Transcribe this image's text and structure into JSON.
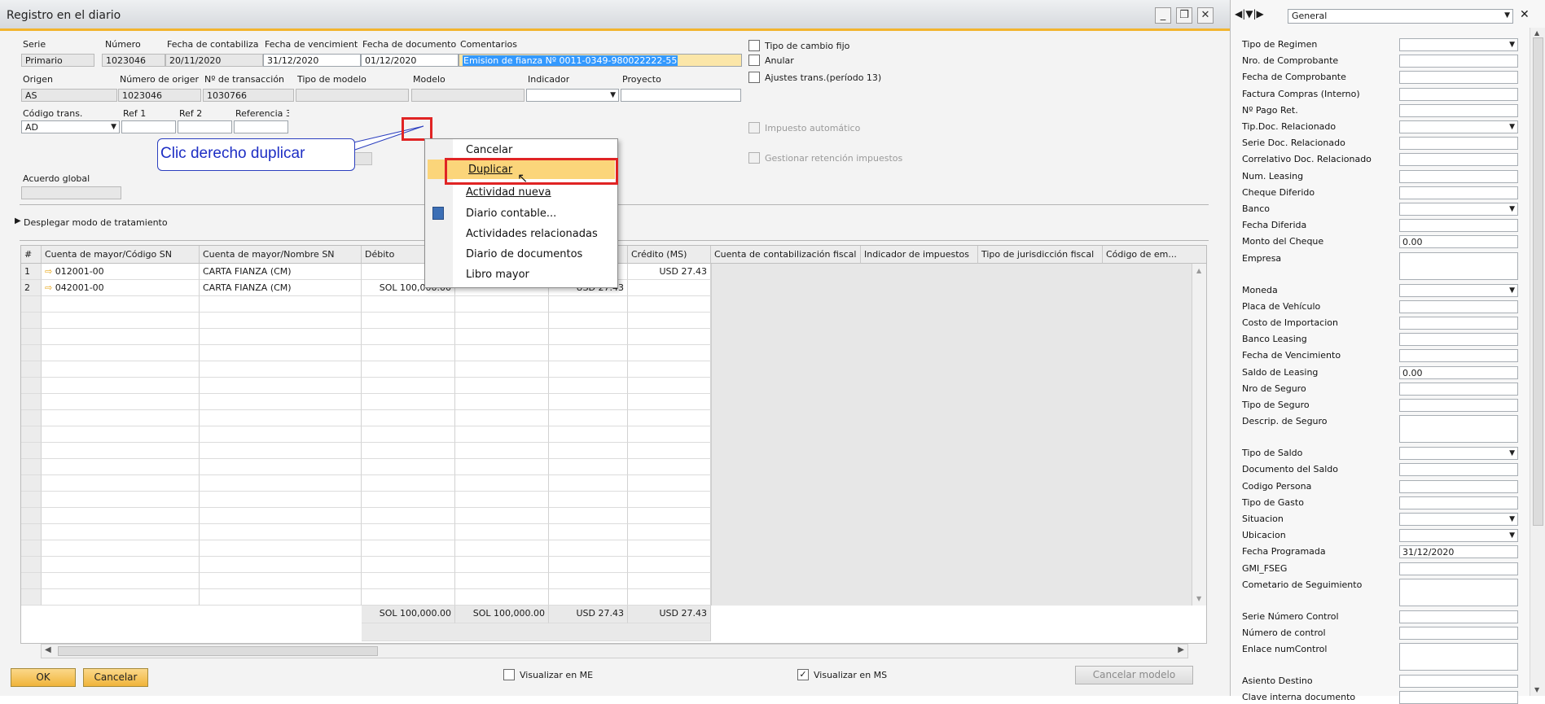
{
  "window": {
    "title": "Registro en el diario"
  },
  "header": {
    "serie": {
      "label": "Serie",
      "value": "Primario"
    },
    "numero": {
      "label": "Número",
      "value": "1023046"
    },
    "fecha_contab": {
      "label": "Fecha de contabiliza",
      "value": "20/11/2020"
    },
    "fecha_venc": {
      "label": "Fecha de vencimient",
      "value": "31/12/2020"
    },
    "fecha_doc": {
      "label": "Fecha de documento",
      "value": "01/12/2020"
    },
    "comentarios": {
      "label": "Comentarios",
      "value": "Emision de fianza Nº 0011-0349-980022222-55"
    },
    "origen": {
      "label": "Origen",
      "value": "AS"
    },
    "num_origen": {
      "label": "Número de origer",
      "value": "1023046"
    },
    "num_trans": {
      "label": "Nº de transacción",
      "value": "1030766"
    },
    "tipo_modelo": {
      "label": "Tipo de modelo",
      "value": ""
    },
    "modelo": {
      "label": "Modelo",
      "value": ""
    },
    "indicador": {
      "label": "Indicador",
      "value": ""
    },
    "proyecto": {
      "label": "Proyecto",
      "value": ""
    },
    "codigo_trans": {
      "label": "Código trans.",
      "value": "AD"
    },
    "ref1": {
      "label": "Ref 1",
      "value": ""
    },
    "ref2": {
      "label": "Ref 2",
      "value": ""
    },
    "ref3": {
      "label": "Referencia 3",
      "value": ""
    },
    "acuerdo_global": {
      "label": "Acuerdo global",
      "value": ""
    },
    "tipo_cambio_fijo": "Tipo de cambio fijo",
    "anular": "Anular",
    "ajustes": "Ajustes trans.(período 13)",
    "impuesto_auto": "Impuesto automático",
    "gestionar_ret": "Gestionar retención impuestos",
    "desplegar": "Desplegar modo de tratamiento"
  },
  "callout": "Clic derecho duplicar",
  "context_menu": {
    "items": [
      "Cancelar",
      "Duplicar",
      "Actividad nueva",
      "Diario contable...",
      "Actividades relacionadas",
      "Diario de documentos",
      "Libro mayor"
    ],
    "highlighted": "Duplicar"
  },
  "grid": {
    "columns": [
      "#",
      "Cuenta de mayor/Código SN",
      "Cuenta de mayor/Nombre SN",
      "Débito",
      "",
      "",
      "Crédito (MS)",
      "Cuenta de contabilización fiscal",
      "Indicador de impuestos",
      "Tipo de jurisdicción fiscal",
      "Código de em..."
    ],
    "rows": [
      {
        "n": "1",
        "code": "012001-00",
        "name": "CARTA FIANZA (CM)",
        "debito": "",
        "c4": "",
        "c5": "",
        "credito_ms": "USD 27.43"
      },
      {
        "n": "2",
        "code": "042001-00",
        "name": "CARTA FIANZA (CM)",
        "debito": "SOL 100,000.00",
        "c4": "",
        "c5": "USD 27.43",
        "credito_ms": ""
      }
    ],
    "totals": [
      "SOL 100,000.00",
      "SOL 100,000.00",
      "USD 27.43",
      "USD 27.43"
    ]
  },
  "footer": {
    "ok": "OK",
    "cancelar": "Cancelar",
    "visualizar_me": "Visualizar en ME",
    "visualizar_ms": "Visualizar en MS",
    "cancelar_modelo": "Cancelar modelo"
  },
  "side": {
    "dropdown": "General",
    "fields": [
      {
        "label": "Tipo de Regimen",
        "value": "",
        "dd": true
      },
      {
        "label": "Nro. de Comprobante",
        "value": ""
      },
      {
        "label": "Fecha de Comprobante",
        "value": ""
      },
      {
        "label": "Factura Compras (Interno)",
        "value": ""
      },
      {
        "label": "Nº Pago Ret.",
        "value": ""
      },
      {
        "label": "Tip.Doc. Relacionado",
        "value": "",
        "dd": true
      },
      {
        "label": "Serie Doc. Relacionado",
        "value": ""
      },
      {
        "label": "Correlativo Doc. Relacionado",
        "value": ""
      },
      {
        "label": "Num. Leasing",
        "value": ""
      },
      {
        "label": "Cheque Diferido",
        "value": ""
      },
      {
        "label": "Banco",
        "value": "",
        "dd": true
      },
      {
        "label": "Fecha Diferida",
        "value": ""
      },
      {
        "label": "Monto del Cheque",
        "value": "0.00"
      },
      {
        "label": "Empresa",
        "value": "",
        "tall": true
      },
      {
        "label": "Moneda",
        "value": "",
        "dd": true
      },
      {
        "label": "Placa de Vehículo",
        "value": ""
      },
      {
        "label": "Costo de Importacion",
        "value": ""
      },
      {
        "label": "Banco Leasing",
        "value": ""
      },
      {
        "label": "Fecha de Vencimiento",
        "value": ""
      },
      {
        "label": "Saldo de Leasing",
        "value": "0.00"
      },
      {
        "label": "Nro de Seguro",
        "value": ""
      },
      {
        "label": "Tipo de Seguro",
        "value": ""
      },
      {
        "label": "Descrip. de Seguro",
        "value": "",
        "tall": true
      },
      {
        "label": "Tipo de Saldo",
        "value": "",
        "dd": true
      },
      {
        "label": "Documento del Saldo",
        "value": ""
      },
      {
        "label": "Codigo Persona",
        "value": ""
      },
      {
        "label": "Tipo de Gasto",
        "value": ""
      },
      {
        "label": "Situacion",
        "value": "",
        "dd": true
      },
      {
        "label": "Ubicacion",
        "value": "",
        "dd": true
      },
      {
        "label": "Fecha Programada",
        "value": "31/12/2020"
      },
      {
        "label": "GMI_FSEG",
        "value": ""
      },
      {
        "label": "Cometario de Seguimiento",
        "value": "",
        "tall": true
      },
      {
        "label": "Serie Número Control",
        "value": ""
      },
      {
        "label": "Número de control",
        "value": ""
      },
      {
        "label": "Enlace numControl",
        "value": "",
        "tall": true
      },
      {
        "label": "Asiento Destino",
        "value": ""
      },
      {
        "label": "Clave interna documento",
        "value": ""
      }
    ]
  }
}
